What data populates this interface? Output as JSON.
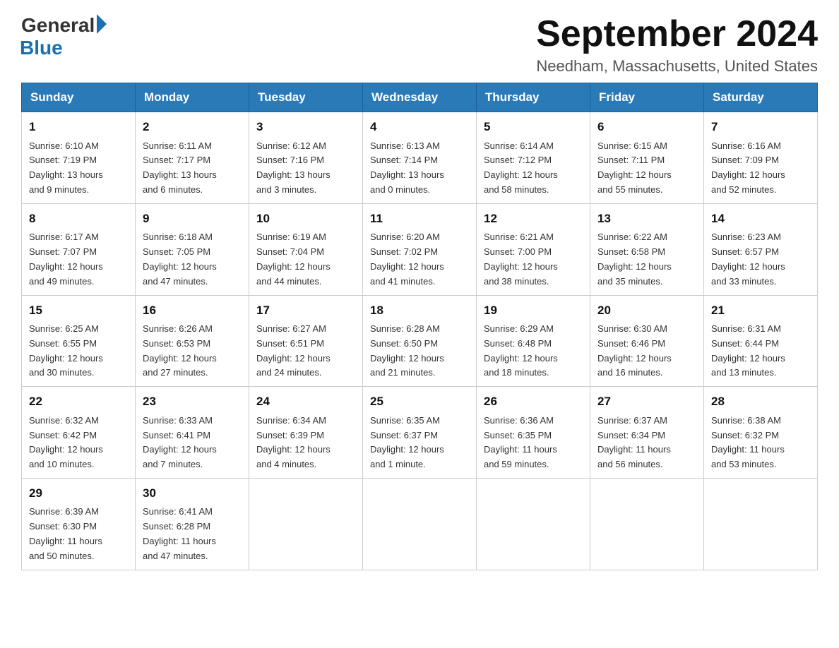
{
  "logo": {
    "general": "General",
    "blue": "Blue"
  },
  "title": {
    "month_year": "September 2024",
    "location": "Needham, Massachusetts, United States"
  },
  "days_of_week": [
    "Sunday",
    "Monday",
    "Tuesday",
    "Wednesday",
    "Thursday",
    "Friday",
    "Saturday"
  ],
  "weeks": [
    [
      {
        "day": "1",
        "sunrise": "6:10 AM",
        "sunset": "7:19 PM",
        "daylight": "13 hours and 9 minutes."
      },
      {
        "day": "2",
        "sunrise": "6:11 AM",
        "sunset": "7:17 PM",
        "daylight": "13 hours and 6 minutes."
      },
      {
        "day": "3",
        "sunrise": "6:12 AM",
        "sunset": "7:16 PM",
        "daylight": "13 hours and 3 minutes."
      },
      {
        "day": "4",
        "sunrise": "6:13 AM",
        "sunset": "7:14 PM",
        "daylight": "13 hours and 0 minutes."
      },
      {
        "day": "5",
        "sunrise": "6:14 AM",
        "sunset": "7:12 PM",
        "daylight": "12 hours and 58 minutes."
      },
      {
        "day": "6",
        "sunrise": "6:15 AM",
        "sunset": "7:11 PM",
        "daylight": "12 hours and 55 minutes."
      },
      {
        "day": "7",
        "sunrise": "6:16 AM",
        "sunset": "7:09 PM",
        "daylight": "12 hours and 52 minutes."
      }
    ],
    [
      {
        "day": "8",
        "sunrise": "6:17 AM",
        "sunset": "7:07 PM",
        "daylight": "12 hours and 49 minutes."
      },
      {
        "day": "9",
        "sunrise": "6:18 AM",
        "sunset": "7:05 PM",
        "daylight": "12 hours and 47 minutes."
      },
      {
        "day": "10",
        "sunrise": "6:19 AM",
        "sunset": "7:04 PM",
        "daylight": "12 hours and 44 minutes."
      },
      {
        "day": "11",
        "sunrise": "6:20 AM",
        "sunset": "7:02 PM",
        "daylight": "12 hours and 41 minutes."
      },
      {
        "day": "12",
        "sunrise": "6:21 AM",
        "sunset": "7:00 PM",
        "daylight": "12 hours and 38 minutes."
      },
      {
        "day": "13",
        "sunrise": "6:22 AM",
        "sunset": "6:58 PM",
        "daylight": "12 hours and 35 minutes."
      },
      {
        "day": "14",
        "sunrise": "6:23 AM",
        "sunset": "6:57 PM",
        "daylight": "12 hours and 33 minutes."
      }
    ],
    [
      {
        "day": "15",
        "sunrise": "6:25 AM",
        "sunset": "6:55 PM",
        "daylight": "12 hours and 30 minutes."
      },
      {
        "day": "16",
        "sunrise": "6:26 AM",
        "sunset": "6:53 PM",
        "daylight": "12 hours and 27 minutes."
      },
      {
        "day": "17",
        "sunrise": "6:27 AM",
        "sunset": "6:51 PM",
        "daylight": "12 hours and 24 minutes."
      },
      {
        "day": "18",
        "sunrise": "6:28 AM",
        "sunset": "6:50 PM",
        "daylight": "12 hours and 21 minutes."
      },
      {
        "day": "19",
        "sunrise": "6:29 AM",
        "sunset": "6:48 PM",
        "daylight": "12 hours and 18 minutes."
      },
      {
        "day": "20",
        "sunrise": "6:30 AM",
        "sunset": "6:46 PM",
        "daylight": "12 hours and 16 minutes."
      },
      {
        "day": "21",
        "sunrise": "6:31 AM",
        "sunset": "6:44 PM",
        "daylight": "12 hours and 13 minutes."
      }
    ],
    [
      {
        "day": "22",
        "sunrise": "6:32 AM",
        "sunset": "6:42 PM",
        "daylight": "12 hours and 10 minutes."
      },
      {
        "day": "23",
        "sunrise": "6:33 AM",
        "sunset": "6:41 PM",
        "daylight": "12 hours and 7 minutes."
      },
      {
        "day": "24",
        "sunrise": "6:34 AM",
        "sunset": "6:39 PM",
        "daylight": "12 hours and 4 minutes."
      },
      {
        "day": "25",
        "sunrise": "6:35 AM",
        "sunset": "6:37 PM",
        "daylight": "12 hours and 1 minute."
      },
      {
        "day": "26",
        "sunrise": "6:36 AM",
        "sunset": "6:35 PM",
        "daylight": "11 hours and 59 minutes."
      },
      {
        "day": "27",
        "sunrise": "6:37 AM",
        "sunset": "6:34 PM",
        "daylight": "11 hours and 56 minutes."
      },
      {
        "day": "28",
        "sunrise": "6:38 AM",
        "sunset": "6:32 PM",
        "daylight": "11 hours and 53 minutes."
      }
    ],
    [
      {
        "day": "29",
        "sunrise": "6:39 AM",
        "sunset": "6:30 PM",
        "daylight": "11 hours and 50 minutes."
      },
      {
        "day": "30",
        "sunrise": "6:41 AM",
        "sunset": "6:28 PM",
        "daylight": "11 hours and 47 minutes."
      },
      null,
      null,
      null,
      null,
      null
    ]
  ],
  "labels": {
    "sunrise": "Sunrise:",
    "sunset": "Sunset:",
    "daylight": "Daylight:"
  }
}
